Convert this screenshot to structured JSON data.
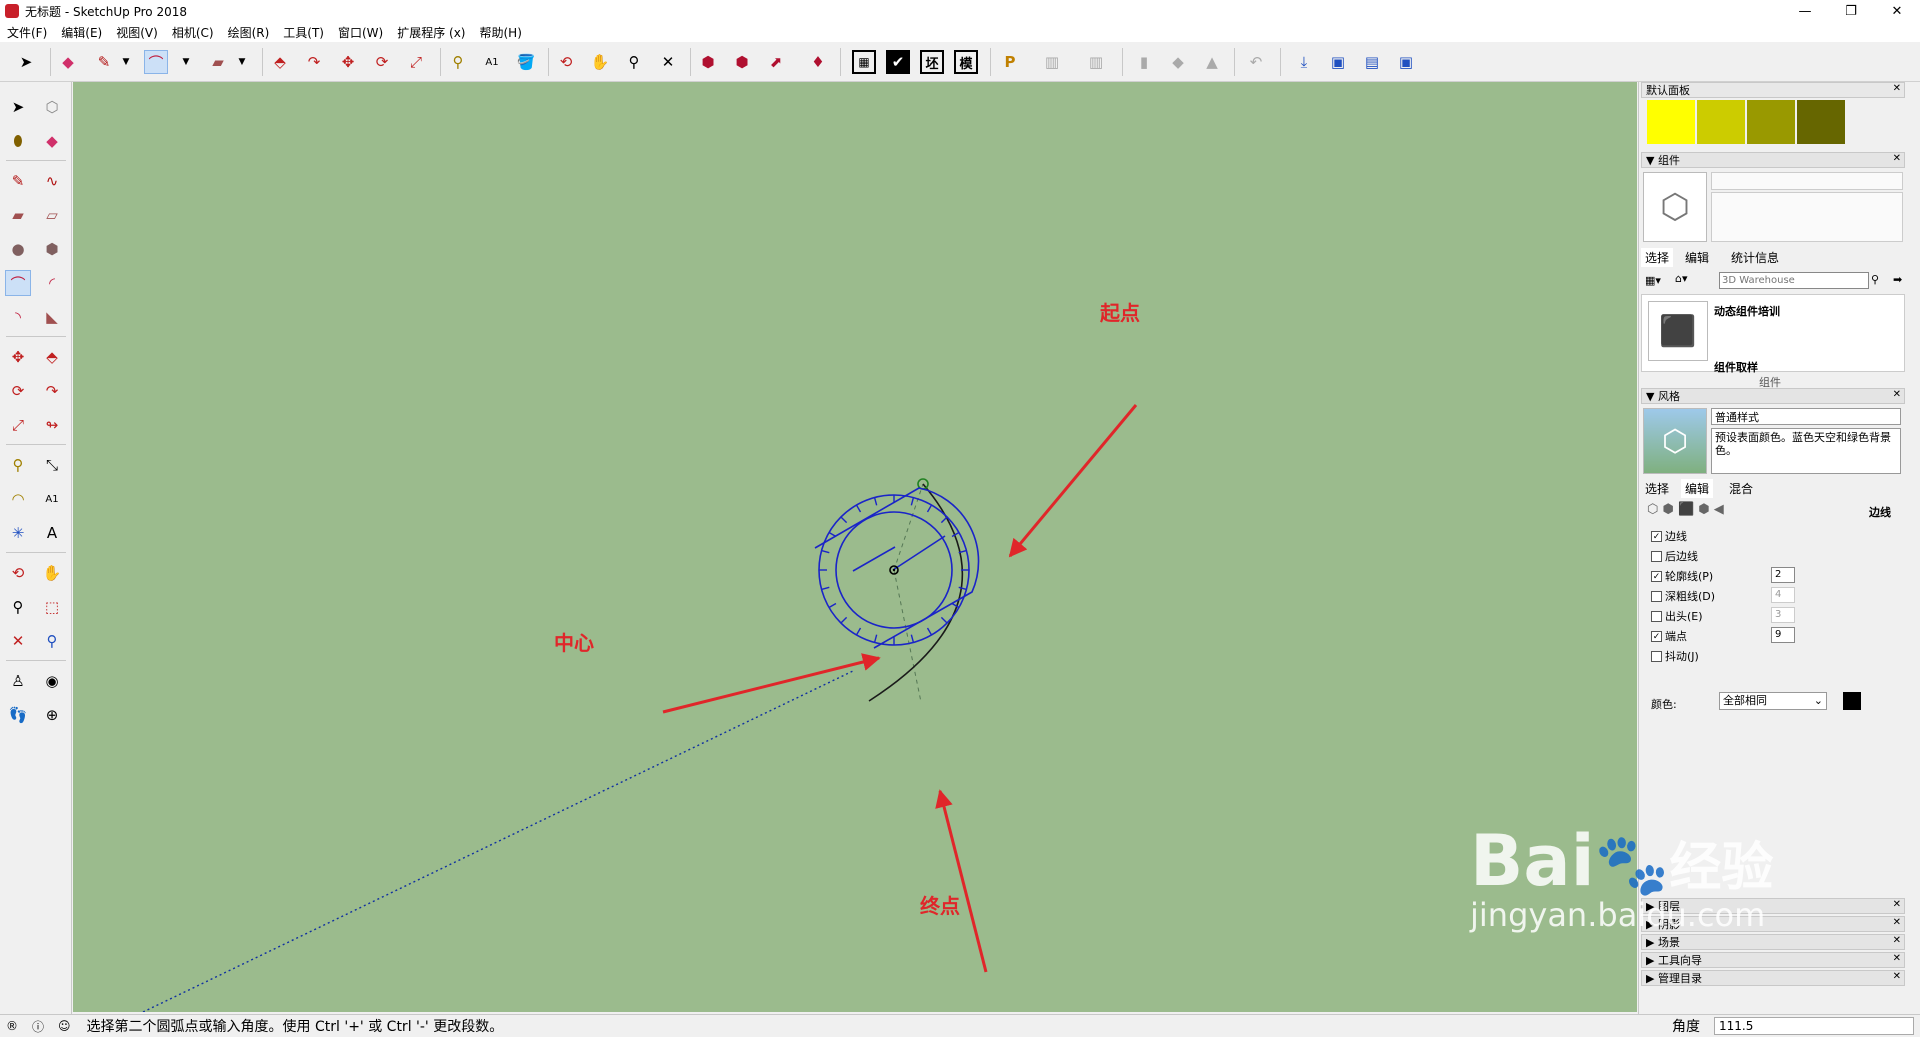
{
  "window": {
    "title": "无标题 - SketchUp Pro 2018",
    "minimize": "—",
    "maximize": "❐",
    "close": "✕"
  },
  "menu": [
    "文件(F)",
    "编辑(E)",
    "视图(V)",
    "相机(C)",
    "绘图(R)",
    "工具(T)",
    "窗口(W)",
    "扩展程序 (x)",
    "帮助(H)"
  ],
  "toolbar": {
    "text_tools": [
      "坯",
      "模"
    ]
  },
  "annotations": {
    "start": "起点",
    "center": "中心",
    "end": "终点"
  },
  "right_panel": {
    "default_tray": "默认面板",
    "swatches": [
      "#ffff00",
      "#cccc00",
      "#999900",
      "#666600"
    ],
    "components": {
      "header": "组件",
      "tabs": [
        "选择",
        "编辑",
        "统计信息"
      ],
      "search_placeholder": "3D Warehouse",
      "items": [
        "动态组件培训",
        "组件取样"
      ],
      "footer": "组件"
    },
    "styles": {
      "header": "风格",
      "style_name": "普通样式",
      "description": "预设表面颜色。蓝色天空和绿色背景色。",
      "tabs": [
        "选择",
        "编辑",
        "混合"
      ],
      "section": "边线",
      "options": [
        {
          "label": "边线",
          "checked": true
        },
        {
          "label": "后边线",
          "checked": false
        },
        {
          "label": "轮廓线(P)",
          "checked": true,
          "value": "2"
        },
        {
          "label": "深粗线(D)",
          "checked": false,
          "value": "4"
        },
        {
          "label": "出头(E)",
          "checked": false,
          "value": "3"
        },
        {
          "label": "端点",
          "checked": true,
          "value": "9"
        },
        {
          "label": "抖动(J)",
          "checked": false
        }
      ],
      "color_label": "颜色:",
      "color_value": "全部相同"
    },
    "collapsed": [
      "图层",
      "阴影",
      "场景",
      "工具向导",
      "管理目录"
    ]
  },
  "status": {
    "message": "选择第二个圆弧点或输入角度。使用 Ctrl '+' 或 Ctrl '-' 更改段数。",
    "measure_label": "角度",
    "measure_value": "111.5"
  },
  "watermark": {
    "brand": "Bai",
    "du": "du",
    "cn": "经验",
    "url": "jingyan.baidu.com"
  }
}
